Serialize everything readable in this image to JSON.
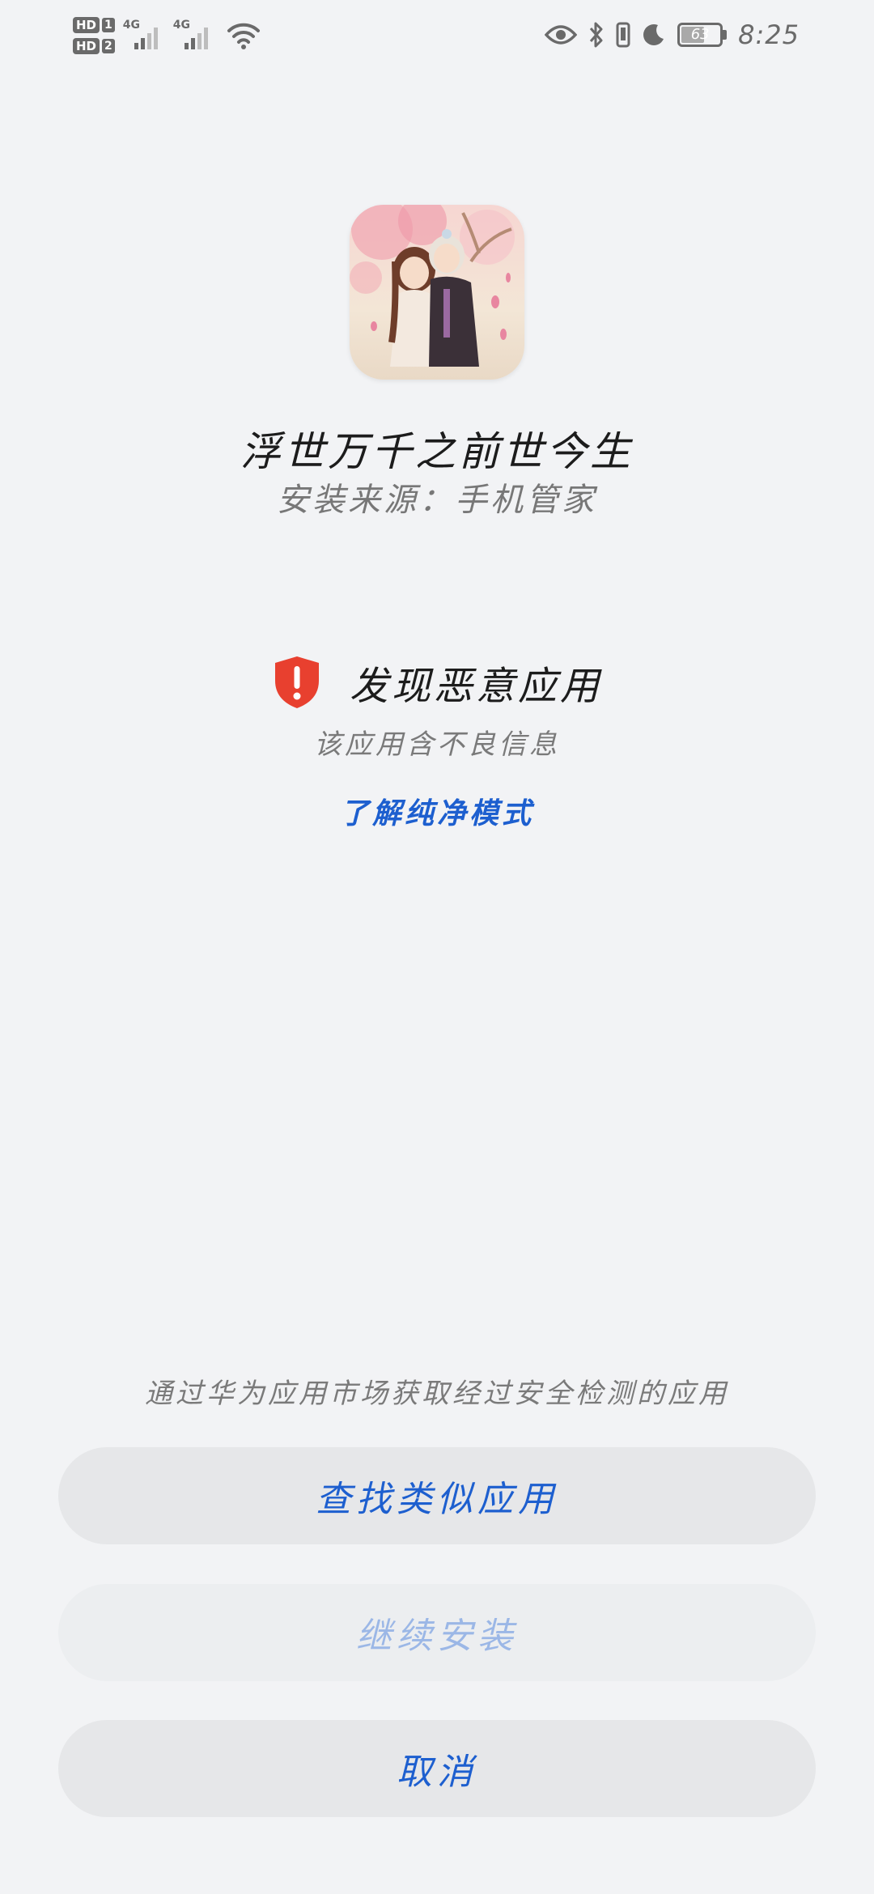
{
  "status_bar": {
    "sim1_badge": "HD",
    "sim1_index": "1",
    "sim2_badge": "HD",
    "sim2_index": "2",
    "sim1_network": "4G",
    "sim2_network": "4G",
    "battery_level": "63",
    "battery_fraction": 0.63,
    "time": "8:25",
    "icons": [
      "signal-icon",
      "wifi-icon",
      "eye-comfort-icon",
      "bluetooth-icon",
      "vibrate-icon",
      "moon-icon",
      "battery-icon"
    ]
  },
  "app": {
    "name": "浮世万千之前世今生",
    "install_source": "安装来源：手机管家"
  },
  "warning": {
    "title": "发现恶意应用",
    "description": "该应用含不良信息",
    "learn_more": "了解纯净模式",
    "icon_color": "#e8402f"
  },
  "footer": {
    "market_note": "通过华为应用市场获取经过安全检测的应用",
    "find_similar": "查找类似应用",
    "continue_install": "继续安装",
    "cancel": "取消"
  },
  "colors": {
    "accent": "#1d5fcf",
    "accent_disabled": "#9bb7e6",
    "background": "#f2f3f5",
    "button_bg": "#e6e7e9"
  }
}
